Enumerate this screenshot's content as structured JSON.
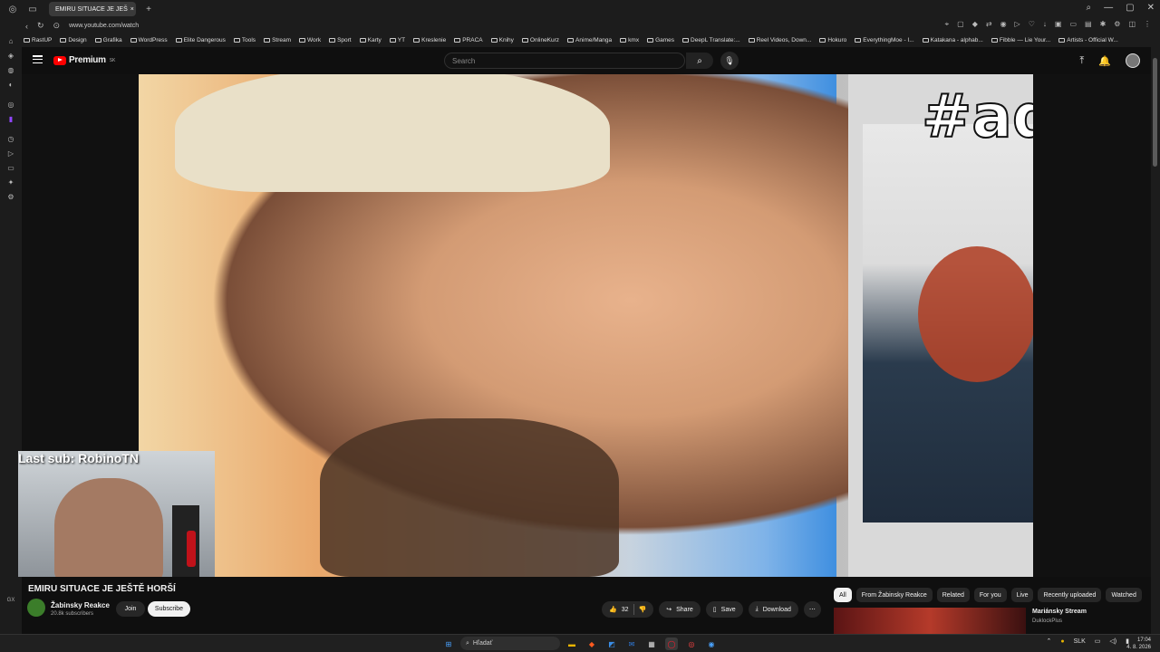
{
  "browser": {
    "tab_title": "EMIRU SITUACE JE JEŠ",
    "url": "www.youtube.com/watch",
    "bookmarks": [
      "RastUP",
      "Design",
      "Grafika",
      "WordPress",
      "Elite Dangerous",
      "Tools",
      "Stream",
      "Work",
      "Sport",
      "Karty",
      "YT",
      "Kreslenie",
      "PRACA",
      "Knihy",
      "OnlineKurz",
      "Anime/Manga",
      "kmx",
      "Games",
      "DeepL Translate:...",
      "Reel Videos, Down...",
      "Hokuro",
      "EverythingMoe - I...",
      "Katakana - alphab...",
      "Fibble — Lie Your...",
      "Artists - Official W..."
    ]
  },
  "youtube": {
    "logo_text": "Premium",
    "region": "SK",
    "search_placeholder": "Search"
  },
  "video": {
    "ad_tag": "#ad",
    "webcam_overlay": "Last sub: RobinoTN"
  },
  "below_video": {
    "title": "EMIRU SITUACE JE JEŠTĚ HORŠÍ",
    "channel_name": "Žabinsky Reakce",
    "subscribers": "20.8k subscribers",
    "join_label": "Join",
    "subscribe_label": "Subscribe",
    "likes": "32",
    "share_label": "Share",
    "save_label": "Save",
    "download_label": "Download"
  },
  "chips": [
    "All",
    "From Žabinsky Reakce",
    "Related",
    "For you",
    "Live",
    "Recently uploaded",
    "Watched"
  ],
  "recommendation": {
    "title": "Mariánsky Stream",
    "channel": "DuklockPlus"
  },
  "left_bottom": "GX",
  "taskbar": {
    "search_placeholder": "Hľadať",
    "language": "SLK",
    "time": "17:04",
    "date": "4. 8. 2026"
  }
}
